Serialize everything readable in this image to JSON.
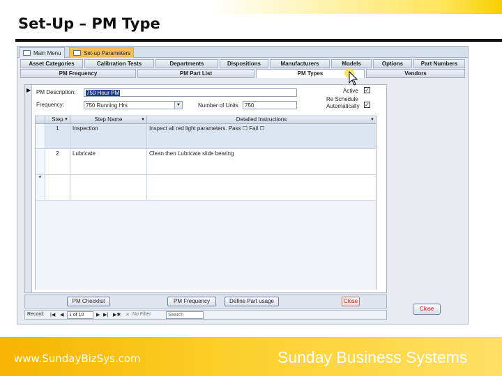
{
  "slide": {
    "title": "Set-Up – PM Type",
    "footer_url": "www.SundayBizSys.com",
    "footer_company": "Sunday Business Systems"
  },
  "doc_tabs": [
    {
      "label": "Main Menu",
      "active": false
    },
    {
      "label": "Set-up Parameters",
      "active": true
    }
  ],
  "tabs_row1": [
    "Asset Categories",
    "Calibration Tests",
    "Departments",
    "Dispositions",
    "Manufacturers",
    "Models",
    "Options",
    "Part Numbers"
  ],
  "tabs_row2": [
    "PM Frequency",
    "PM Part List",
    "PM Types",
    "Vendors"
  ],
  "active_tab": "PM Types",
  "form": {
    "pm_description_label": "PM Description:",
    "pm_description_value": "750 Hour PM",
    "frequency_label": "Frequency:",
    "frequency_value": "750 Running Hrs",
    "units_label": "Number of Units",
    "units_value": "750",
    "active_label": "Active",
    "active_checked": true,
    "reschedule_label_1": "Re Schedule",
    "reschedule_label_2": "Automatically",
    "reschedule_checked": true
  },
  "steps": {
    "headers": [
      "Step",
      "Step Name",
      "Detailed Instructions"
    ],
    "rows": [
      {
        "step": "1",
        "name": "Inspection",
        "instructions": "Inspect all red light parameters. Pass ☐   Fail ☐"
      },
      {
        "step": "2",
        "name": "Lubricate",
        "instructions": "Clean then Lubricate slide bearing"
      }
    ],
    "new_row_marker": "*"
  },
  "buttons": {
    "pm_checklist": "PM Checklist",
    "pm_frequency": "PM Frequency",
    "define_part_usage": "Define Part usage",
    "close_inner": "Close",
    "close_outer": "Close"
  },
  "navigation": {
    "record_label": "Record:",
    "position": "1 of 10",
    "no_filter": "No Filter",
    "search": "Search"
  },
  "colors": {
    "footer_start": "#f7b400",
    "footer_end": "#ffe066",
    "active_doc_tab": "#f2c25a",
    "close_text": "#cc1111"
  }
}
